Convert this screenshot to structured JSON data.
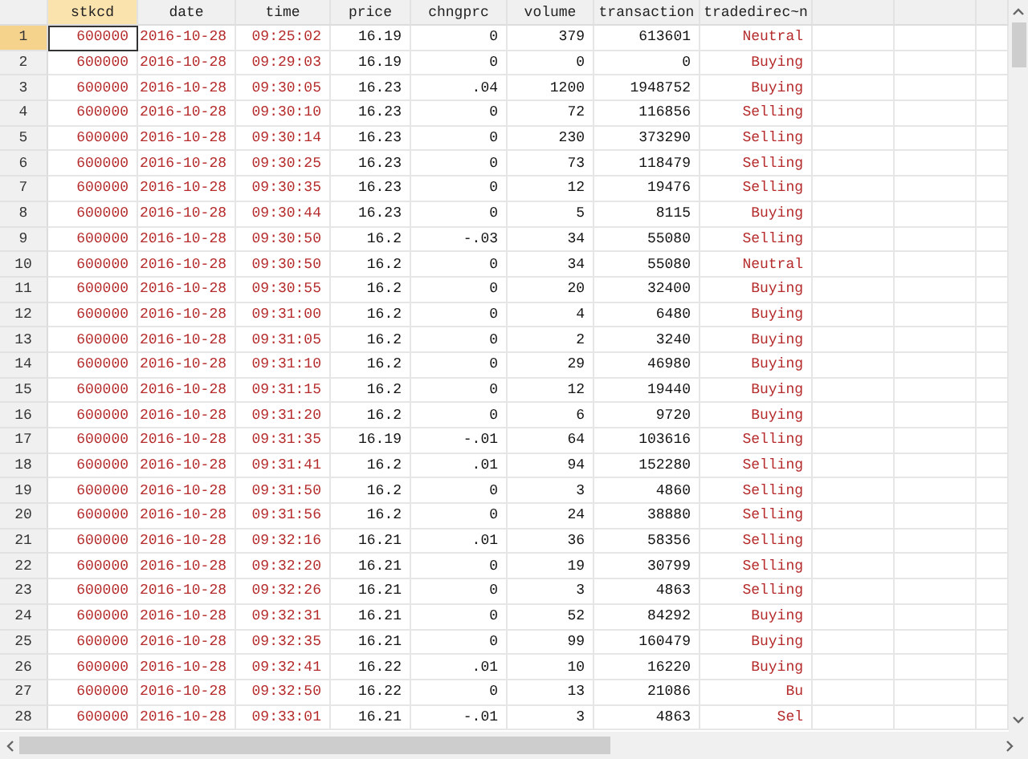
{
  "columns": [
    {
      "label": "stkcd",
      "kind": "string",
      "selected": true
    },
    {
      "label": "date",
      "kind": "string",
      "selected": false
    },
    {
      "label": "time",
      "kind": "string",
      "selected": false
    },
    {
      "label": "price",
      "kind": "numeric",
      "selected": false
    },
    {
      "label": "chngprc",
      "kind": "numeric",
      "selected": false
    },
    {
      "label": "volume",
      "kind": "numeric",
      "selected": false
    },
    {
      "label": "transaction",
      "kind": "numeric",
      "selected": false
    },
    {
      "label": "tradedirec~n",
      "kind": "string",
      "selected": false
    }
  ],
  "rows": [
    {
      "num": "1",
      "selected": true,
      "cells": [
        "600000",
        "2016-10-28",
        "09:25:02",
        "16.19",
        "0",
        "379",
        "613601",
        "Neutral"
      ]
    },
    {
      "num": "2",
      "selected": false,
      "cells": [
        "600000",
        "2016-10-28",
        "09:29:03",
        "16.19",
        "0",
        "0",
        "0",
        "Buying"
      ]
    },
    {
      "num": "3",
      "selected": false,
      "cells": [
        "600000",
        "2016-10-28",
        "09:30:05",
        "16.23",
        ".04",
        "1200",
        "1948752",
        "Buying"
      ]
    },
    {
      "num": "4",
      "selected": false,
      "cells": [
        "600000",
        "2016-10-28",
        "09:30:10",
        "16.23",
        "0",
        "72",
        "116856",
        "Selling"
      ]
    },
    {
      "num": "5",
      "selected": false,
      "cells": [
        "600000",
        "2016-10-28",
        "09:30:14",
        "16.23",
        "0",
        "230",
        "373290",
        "Selling"
      ]
    },
    {
      "num": "6",
      "selected": false,
      "cells": [
        "600000",
        "2016-10-28",
        "09:30:25",
        "16.23",
        "0",
        "73",
        "118479",
        "Selling"
      ]
    },
    {
      "num": "7",
      "selected": false,
      "cells": [
        "600000",
        "2016-10-28",
        "09:30:35",
        "16.23",
        "0",
        "12",
        "19476",
        "Selling"
      ]
    },
    {
      "num": "8",
      "selected": false,
      "cells": [
        "600000",
        "2016-10-28",
        "09:30:44",
        "16.23",
        "0",
        "5",
        "8115",
        "Buying"
      ]
    },
    {
      "num": "9",
      "selected": false,
      "cells": [
        "600000",
        "2016-10-28",
        "09:30:50",
        "16.2",
        "-.03",
        "34",
        "55080",
        "Selling"
      ]
    },
    {
      "num": "10",
      "selected": false,
      "cells": [
        "600000",
        "2016-10-28",
        "09:30:50",
        "16.2",
        "0",
        "34",
        "55080",
        "Neutral"
      ]
    },
    {
      "num": "11",
      "selected": false,
      "cells": [
        "600000",
        "2016-10-28",
        "09:30:55",
        "16.2",
        "0",
        "20",
        "32400",
        "Buying"
      ]
    },
    {
      "num": "12",
      "selected": false,
      "cells": [
        "600000",
        "2016-10-28",
        "09:31:00",
        "16.2",
        "0",
        "4",
        "6480",
        "Buying"
      ]
    },
    {
      "num": "13",
      "selected": false,
      "cells": [
        "600000",
        "2016-10-28",
        "09:31:05",
        "16.2",
        "0",
        "2",
        "3240",
        "Buying"
      ]
    },
    {
      "num": "14",
      "selected": false,
      "cells": [
        "600000",
        "2016-10-28",
        "09:31:10",
        "16.2",
        "0",
        "29",
        "46980",
        "Buying"
      ]
    },
    {
      "num": "15",
      "selected": false,
      "cells": [
        "600000",
        "2016-10-28",
        "09:31:15",
        "16.2",
        "0",
        "12",
        "19440",
        "Buying"
      ]
    },
    {
      "num": "16",
      "selected": false,
      "cells": [
        "600000",
        "2016-10-28",
        "09:31:20",
        "16.2",
        "0",
        "6",
        "9720",
        "Buying"
      ]
    },
    {
      "num": "17",
      "selected": false,
      "cells": [
        "600000",
        "2016-10-28",
        "09:31:35",
        "16.19",
        "-.01",
        "64",
        "103616",
        "Selling"
      ]
    },
    {
      "num": "18",
      "selected": false,
      "cells": [
        "600000",
        "2016-10-28",
        "09:31:41",
        "16.2",
        ".01",
        "94",
        "152280",
        "Selling"
      ]
    },
    {
      "num": "19",
      "selected": false,
      "cells": [
        "600000",
        "2016-10-28",
        "09:31:50",
        "16.2",
        "0",
        "3",
        "4860",
        "Selling"
      ]
    },
    {
      "num": "20",
      "selected": false,
      "cells": [
        "600000",
        "2016-10-28",
        "09:31:56",
        "16.2",
        "0",
        "24",
        "38880",
        "Selling"
      ]
    },
    {
      "num": "21",
      "selected": false,
      "cells": [
        "600000",
        "2016-10-28",
        "09:32:16",
        "16.21",
        ".01",
        "36",
        "58356",
        "Selling"
      ]
    },
    {
      "num": "22",
      "selected": false,
      "cells": [
        "600000",
        "2016-10-28",
        "09:32:20",
        "16.21",
        "0",
        "19",
        "30799",
        "Selling"
      ]
    },
    {
      "num": "23",
      "selected": false,
      "cells": [
        "600000",
        "2016-10-28",
        "09:32:26",
        "16.21",
        "0",
        "3",
        "4863",
        "Selling"
      ]
    },
    {
      "num": "24",
      "selected": false,
      "cells": [
        "600000",
        "2016-10-28",
        "09:32:31",
        "16.21",
        "0",
        "52",
        "84292",
        "Buying"
      ]
    },
    {
      "num": "25",
      "selected": false,
      "cells": [
        "600000",
        "2016-10-28",
        "09:32:35",
        "16.21",
        "0",
        "99",
        "160479",
        "Buying"
      ]
    },
    {
      "num": "26",
      "selected": false,
      "cells": [
        "600000",
        "2016-10-28",
        "09:32:41",
        "16.22",
        ".01",
        "10",
        "16220",
        "Buying"
      ]
    },
    {
      "num": "27",
      "selected": false,
      "cells": [
        "600000",
        "2016-10-28",
        "09:32:50",
        "16.22",
        "0",
        "13",
        "21086",
        "Bu"
      ]
    },
    {
      "num": "28",
      "selected": false,
      "cells": [
        "600000",
        "2016-10-28",
        "09:33:01",
        "16.21",
        "-.01",
        "3",
        "4863",
        "Sel"
      ]
    }
  ]
}
